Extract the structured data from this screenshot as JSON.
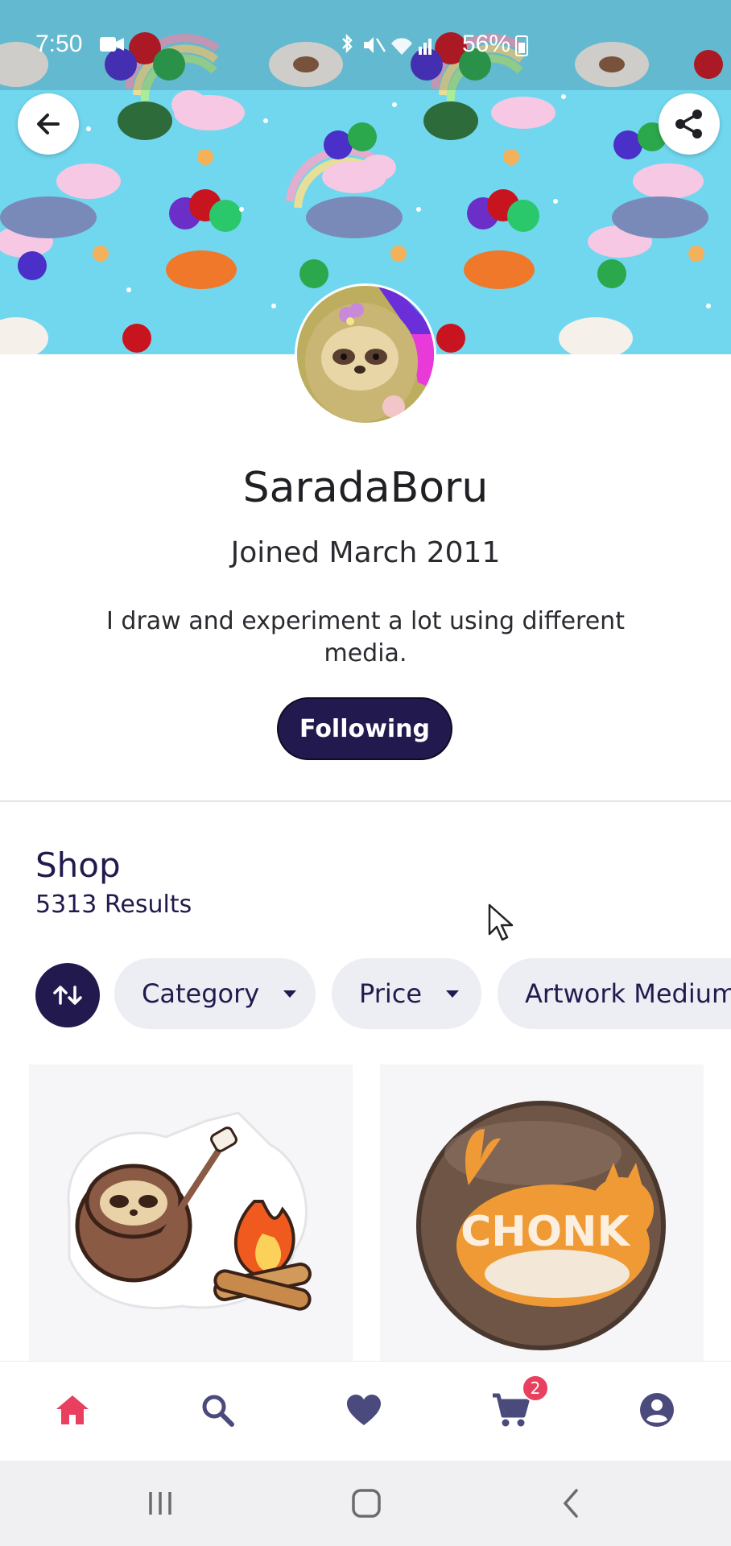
{
  "status_bar": {
    "time": "7:50",
    "battery": "56%"
  },
  "profile": {
    "name": "SaradaBoru",
    "joined": "Joined March 2011",
    "bio": "I draw and experiment a lot using different media.",
    "follow_label": "Following"
  },
  "shop": {
    "title": "Shop",
    "results": "5313 Results",
    "filters": {
      "category": "Category",
      "price": "Price",
      "medium": "Artwork Medium"
    }
  },
  "products": [
    {
      "image": "sloth-campfire-sticker"
    },
    {
      "image": "chonk-cat-button"
    }
  ],
  "bottom_nav": {
    "items": [
      "home-icon",
      "search-icon",
      "heart-icon",
      "cart-icon",
      "account-icon"
    ],
    "cart_count": "2",
    "active_color": "#e8405e",
    "inactive_color": "#4b4a7d"
  },
  "colors": {
    "brand": "#221a4e",
    "banner": "#6fd6ef"
  }
}
